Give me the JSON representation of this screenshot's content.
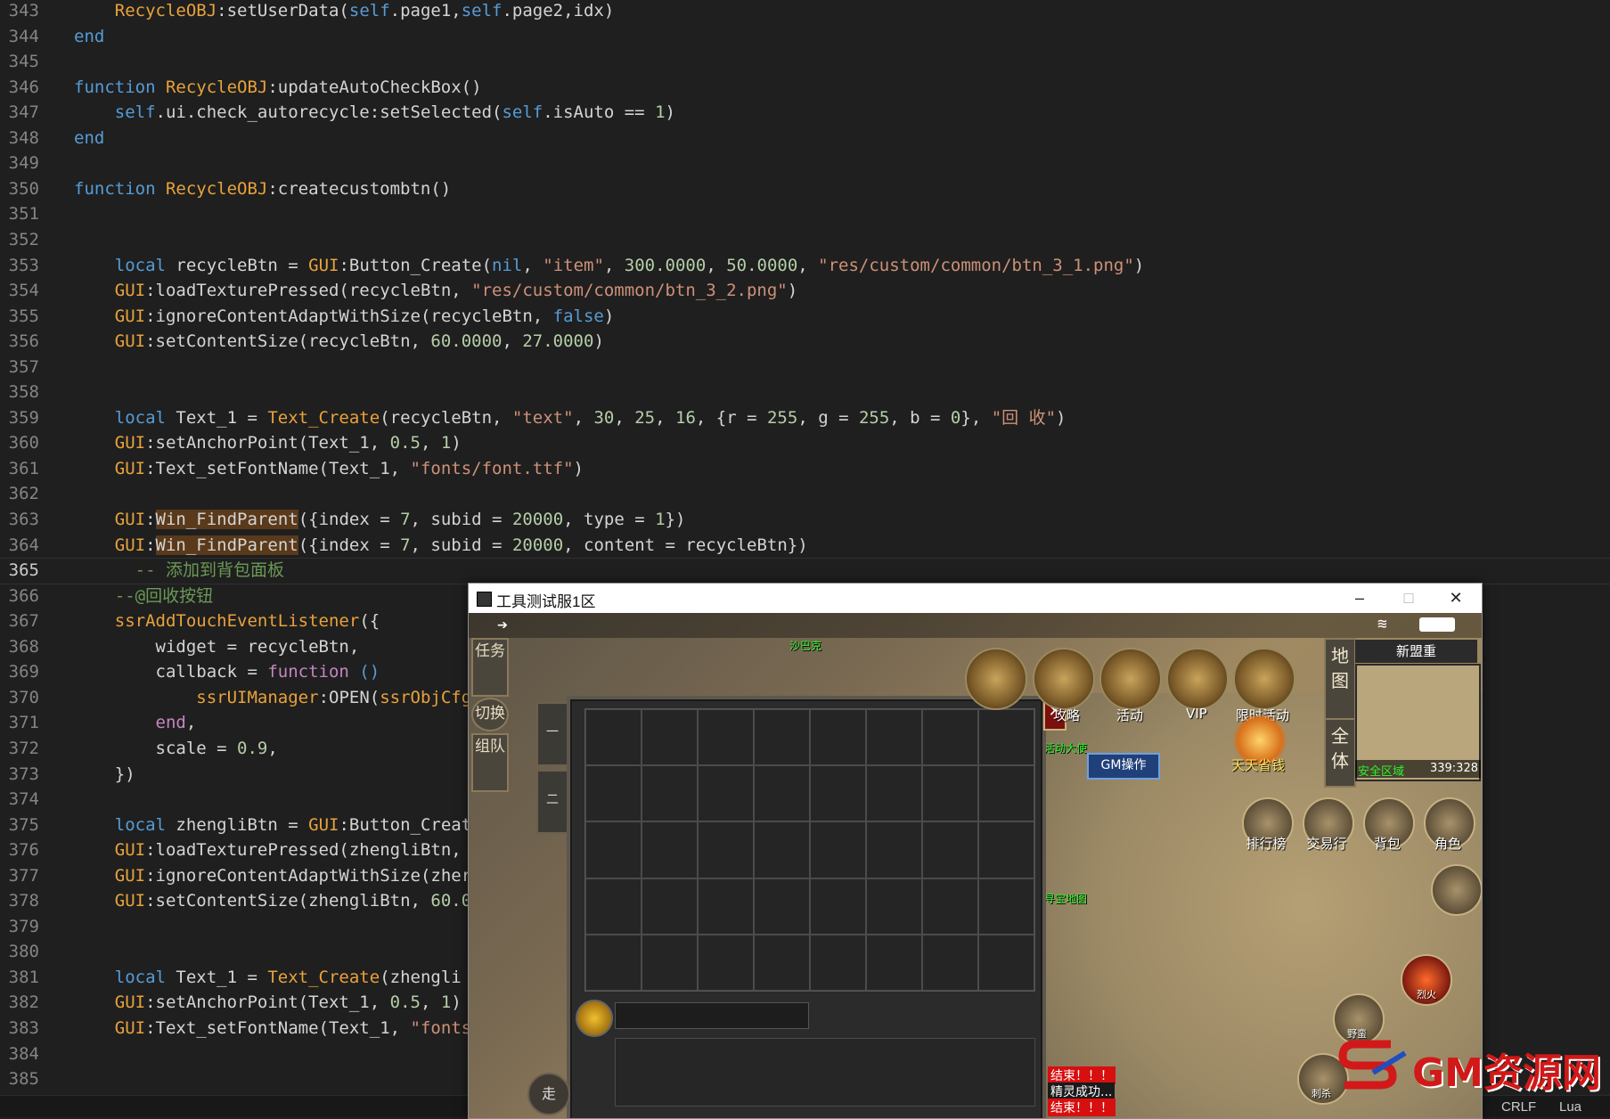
{
  "editor": {
    "lines": [
      {
        "n": "343",
        "tokens": [
          [
            "    ",
            ""
          ],
          [
            "RecycleOBJ",
            "cls"
          ],
          [
            ":setUserData(",
            ""
          ],
          [
            "self",
            "self"
          ],
          [
            ".page1,",
            ""
          ],
          [
            "self",
            "self"
          ],
          [
            ".page2,idx)",
            ""
          ]
        ]
      },
      {
        "n": "344",
        "tokens": [
          [
            "end",
            "fnk"
          ]
        ]
      },
      {
        "n": "345",
        "tokens": []
      },
      {
        "n": "346",
        "tokens": [
          [
            "function ",
            "fnk"
          ],
          [
            "RecycleOBJ",
            "cls"
          ],
          [
            ":updateAutoCheckBox()",
            ""
          ]
        ]
      },
      {
        "n": "347",
        "tokens": [
          [
            "    ",
            ""
          ],
          [
            "self",
            "self"
          ],
          [
            ".ui.check_autorecycle:setSelected(",
            ""
          ],
          [
            "self",
            "self"
          ],
          [
            ".isAuto == ",
            ""
          ],
          [
            "1",
            "num"
          ],
          [
            ")",
            ""
          ]
        ]
      },
      {
        "n": "348",
        "tokens": [
          [
            "end",
            "fnk"
          ]
        ]
      },
      {
        "n": "349",
        "tokens": []
      },
      {
        "n": "350",
        "tokens": [
          [
            "function ",
            "fnk"
          ],
          [
            "RecycleOBJ",
            "cls"
          ],
          [
            ":createcustombtn()",
            ""
          ]
        ]
      },
      {
        "n": "351",
        "tokens": []
      },
      {
        "n": "352",
        "tokens": []
      },
      {
        "n": "353",
        "tokens": [
          [
            "    ",
            ""
          ],
          [
            "local ",
            "fnk"
          ],
          [
            "recycleBtn = ",
            ""
          ],
          [
            "GUI",
            "cls"
          ],
          [
            ":Button_Create(",
            ""
          ],
          [
            "nil",
            "self"
          ],
          [
            ", ",
            ""
          ],
          [
            "\"item\"",
            "str"
          ],
          [
            ", ",
            ""
          ],
          [
            "300.0000",
            "num"
          ],
          [
            ", ",
            ""
          ],
          [
            "50.0000",
            "num"
          ],
          [
            ", ",
            ""
          ],
          [
            "\"res/custom/common/btn_3_1.png\"",
            "str"
          ],
          [
            ")",
            ""
          ]
        ]
      },
      {
        "n": "354",
        "tokens": [
          [
            "    ",
            ""
          ],
          [
            "GUI",
            "cls"
          ],
          [
            ":loadTexturePressed(recycleBtn, ",
            ""
          ],
          [
            "\"res/custom/common/btn_3_2.png\"",
            "str"
          ],
          [
            ")",
            ""
          ]
        ]
      },
      {
        "n": "355",
        "tokens": [
          [
            "    ",
            ""
          ],
          [
            "GUI",
            "cls"
          ],
          [
            ":ignoreContentAdaptWithSize(recycleBtn, ",
            ""
          ],
          [
            "false",
            "self"
          ],
          [
            ")",
            ""
          ]
        ]
      },
      {
        "n": "356",
        "tokens": [
          [
            "    ",
            ""
          ],
          [
            "GUI",
            "cls"
          ],
          [
            ":setContentSize(recycleBtn, ",
            ""
          ],
          [
            "60.0000",
            "num"
          ],
          [
            ", ",
            ""
          ],
          [
            "27.0000",
            "num"
          ],
          [
            ")",
            ""
          ]
        ]
      },
      {
        "n": "357",
        "tokens": []
      },
      {
        "n": "358",
        "tokens": []
      },
      {
        "n": "359",
        "tokens": [
          [
            "    ",
            ""
          ],
          [
            "local ",
            "fnk"
          ],
          [
            "Text_1 = ",
            ""
          ],
          [
            "Text_Create",
            "cls"
          ],
          [
            "(recycleBtn, ",
            ""
          ],
          [
            "\"text\"",
            "str"
          ],
          [
            ", ",
            ""
          ],
          [
            "30",
            "num"
          ],
          [
            ", ",
            ""
          ],
          [
            "25",
            "num"
          ],
          [
            ", ",
            ""
          ],
          [
            "16",
            "num"
          ],
          [
            ", {r = ",
            ""
          ],
          [
            "255",
            "num"
          ],
          [
            ", g = ",
            ""
          ],
          [
            "255",
            "num"
          ],
          [
            ", b = ",
            ""
          ],
          [
            "0",
            "num"
          ],
          [
            "}, ",
            ""
          ],
          [
            "\"回 收\"",
            "str"
          ],
          [
            ")",
            ""
          ]
        ]
      },
      {
        "n": "360",
        "tokens": [
          [
            "    ",
            ""
          ],
          [
            "GUI",
            "cls"
          ],
          [
            ":setAnchorPoint(Text_1, ",
            ""
          ],
          [
            "0.5",
            "num"
          ],
          [
            ", ",
            ""
          ],
          [
            "1",
            "num"
          ],
          [
            ")",
            ""
          ]
        ]
      },
      {
        "n": "361",
        "tokens": [
          [
            "    ",
            ""
          ],
          [
            "GUI",
            "cls"
          ],
          [
            ":Text_setFontName(Text_1, ",
            ""
          ],
          [
            "\"fonts/font.ttf\"",
            "str"
          ],
          [
            ")",
            ""
          ]
        ]
      },
      {
        "n": "362",
        "tokens": []
      },
      {
        "n": "363",
        "tokens": [
          [
            "    ",
            ""
          ],
          [
            "GUI",
            "cls"
          ],
          [
            ":",
            ""
          ],
          [
            "Win_FindParent",
            "hl"
          ],
          [
            "({index = ",
            ""
          ],
          [
            "7",
            "num"
          ],
          [
            ", subid = ",
            ""
          ],
          [
            "20000",
            "num"
          ],
          [
            ", type = ",
            ""
          ],
          [
            "1",
            "num"
          ],
          [
            "})",
            ""
          ]
        ]
      },
      {
        "n": "364",
        "tokens": [
          [
            "    ",
            ""
          ],
          [
            "GUI",
            "cls"
          ],
          [
            ":",
            ""
          ],
          [
            "Win_FindParent",
            "hl"
          ],
          [
            "({index = ",
            ""
          ],
          [
            "7",
            "num"
          ],
          [
            ", subid = ",
            ""
          ],
          [
            "20000",
            "num"
          ],
          [
            ", content = recycleBtn})",
            ""
          ]
        ]
      },
      {
        "n": "365",
        "tokens": [
          [
            "      ",
            ""
          ],
          [
            "-- 添加到背包面板",
            "cmt"
          ]
        ]
      },
      {
        "n": "366",
        "tokens": [
          [
            "    ",
            ""
          ],
          [
            "--@回收按钮",
            "cmt"
          ]
        ]
      },
      {
        "n": "367",
        "tokens": [
          [
            "    ",
            ""
          ],
          [
            "ssrAddTouchEventListener",
            "cls"
          ],
          [
            "({",
            ""
          ]
        ]
      },
      {
        "n": "368",
        "tokens": [
          [
            "        widget = recycleBtn,",
            ""
          ]
        ]
      },
      {
        "n": "369",
        "tokens": [
          [
            "        callback = ",
            ""
          ],
          [
            "function ",
            "kw"
          ],
          [
            "()",
            "self"
          ]
        ]
      },
      {
        "n": "370",
        "tokens": [
          [
            "            ",
            ""
          ],
          [
            "ssrUIManager",
            "cls"
          ],
          [
            ":OPEN(",
            ""
          ],
          [
            "ssrObjCfg",
            "cls"
          ]
        ]
      },
      {
        "n": "371",
        "tokens": [
          [
            "        ",
            ""
          ],
          [
            "end",
            "kw"
          ],
          [
            ",",
            ""
          ]
        ]
      },
      {
        "n": "372",
        "tokens": [
          [
            "        scale = ",
            ""
          ],
          [
            "0.9",
            "num"
          ],
          [
            ",",
            ""
          ]
        ]
      },
      {
        "n": "373",
        "tokens": [
          [
            "    })",
            ""
          ]
        ]
      },
      {
        "n": "374",
        "tokens": []
      },
      {
        "n": "375",
        "tokens": [
          [
            "    ",
            ""
          ],
          [
            "local ",
            "fnk"
          ],
          [
            "zhengliBtn = ",
            ""
          ],
          [
            "GUI",
            "cls"
          ],
          [
            ":Button_Creat",
            ""
          ]
        ]
      },
      {
        "n": "376",
        "tokens": [
          [
            "    ",
            ""
          ],
          [
            "GUI",
            "cls"
          ],
          [
            ":loadTexturePressed(zhengliBtn,",
            ""
          ]
        ]
      },
      {
        "n": "377",
        "tokens": [
          [
            "    ",
            ""
          ],
          [
            "GUI",
            "cls"
          ],
          [
            ":ignoreContentAdaptWithSize(zher",
            ""
          ]
        ]
      },
      {
        "n": "378",
        "tokens": [
          [
            "    ",
            ""
          ],
          [
            "GUI",
            "cls"
          ],
          [
            ":setContentSize(zhengliBtn, ",
            ""
          ],
          [
            "60.0",
            "num"
          ]
        ]
      },
      {
        "n": "379",
        "tokens": []
      },
      {
        "n": "380",
        "tokens": []
      },
      {
        "n": "381",
        "tokens": [
          [
            "    ",
            ""
          ],
          [
            "local ",
            "fnk"
          ],
          [
            "Text_1 = ",
            ""
          ],
          [
            "Text_Create",
            "cls"
          ],
          [
            "(zhengli",
            ""
          ]
        ]
      },
      {
        "n": "382",
        "tokens": [
          [
            "    ",
            ""
          ],
          [
            "GUI",
            "cls"
          ],
          [
            ":setAnchorPoint(Text_1, ",
            ""
          ],
          [
            "0.5",
            "num"
          ],
          [
            ", ",
            ""
          ],
          [
            "1",
            "num"
          ],
          [
            ")",
            ""
          ]
        ]
      },
      {
        "n": "383",
        "tokens": [
          [
            "    ",
            ""
          ],
          [
            "GUI",
            "cls"
          ],
          [
            ":Text_setFontName(Text_1, ",
            ""
          ],
          [
            "\"fonts",
            "str"
          ]
        ]
      },
      {
        "n": "384",
        "tokens": []
      },
      {
        "n": "385",
        "tokens": []
      }
    ],
    "current_line": "365"
  },
  "statusbar": {
    "eol": "CRLF",
    "language": "Lua"
  },
  "window": {
    "title": "工具测试服1区",
    "minimize": "–",
    "maximize": "□",
    "close": "✕"
  },
  "game": {
    "left_tabs": [
      "任务",
      "切换",
      "组队"
    ],
    "bag_tabs": [
      "一",
      "二"
    ],
    "bag_close": "✕",
    "walk_label": "走",
    "top_icons": [
      {
        "label": "攻略"
      },
      {
        "label": "活动"
      },
      {
        "label": "VIP"
      },
      {
        "label": "限时活动"
      }
    ],
    "gift_label": "天天省钱",
    "gm_button": "GM操作",
    "map": {
      "name": "新盟重",
      "zone": "安全区域",
      "coords": "339:328"
    },
    "map_tabs": [
      "地图",
      "全体"
    ],
    "round_buttons": [
      "排行榜",
      "交易行",
      "背包",
      "角色"
    ],
    "skill_labels": [
      "烈火",
      "野蛮",
      "刺杀"
    ],
    "npc_names": [
      "沙巴克",
      "活动大使",
      "寻宝地图"
    ],
    "chat_lines": [
      "结束！！！",
      "精灵成功...",
      "结束！！！"
    ]
  },
  "watermark": "GM资源网",
  "colors": {
    "editor_bg": "#1f1f1f",
    "keyword": "#569cd6",
    "class": "#e8a23b",
    "string": "#ce9178",
    "number": "#b5cea8",
    "comment": "#6a9955"
  }
}
